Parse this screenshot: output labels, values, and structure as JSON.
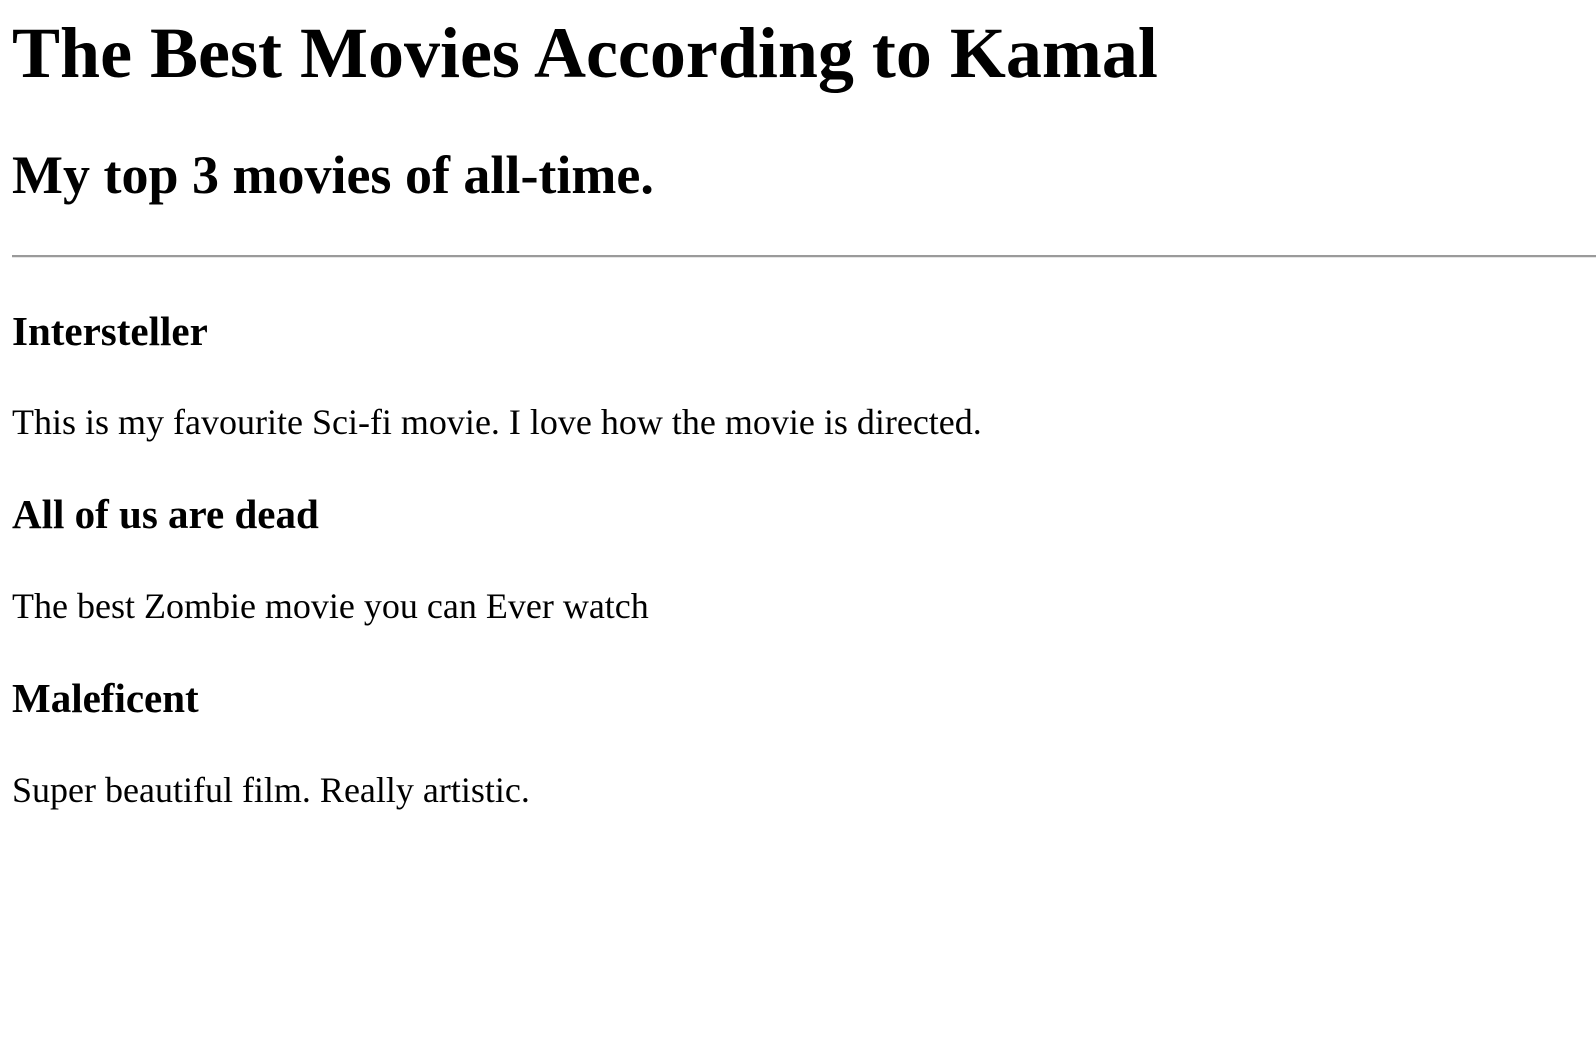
{
  "header": {
    "title": "The Best Movies According to Kamal",
    "subtitle": "My top 3 movies of all-time."
  },
  "movies": [
    {
      "title": "Intersteller",
      "description": "This is my favourite Sci-fi movie. I love how the movie is directed."
    },
    {
      "title": "All of us are dead",
      "description": "The best Zombie movie you can Ever watch"
    },
    {
      "title": "Maleficent",
      "description": "Super beautiful film. Really artistic."
    }
  ],
  "colors": {
    "text": "#000000",
    "background": "#ffffff",
    "divider": "#9a9a9a"
  }
}
